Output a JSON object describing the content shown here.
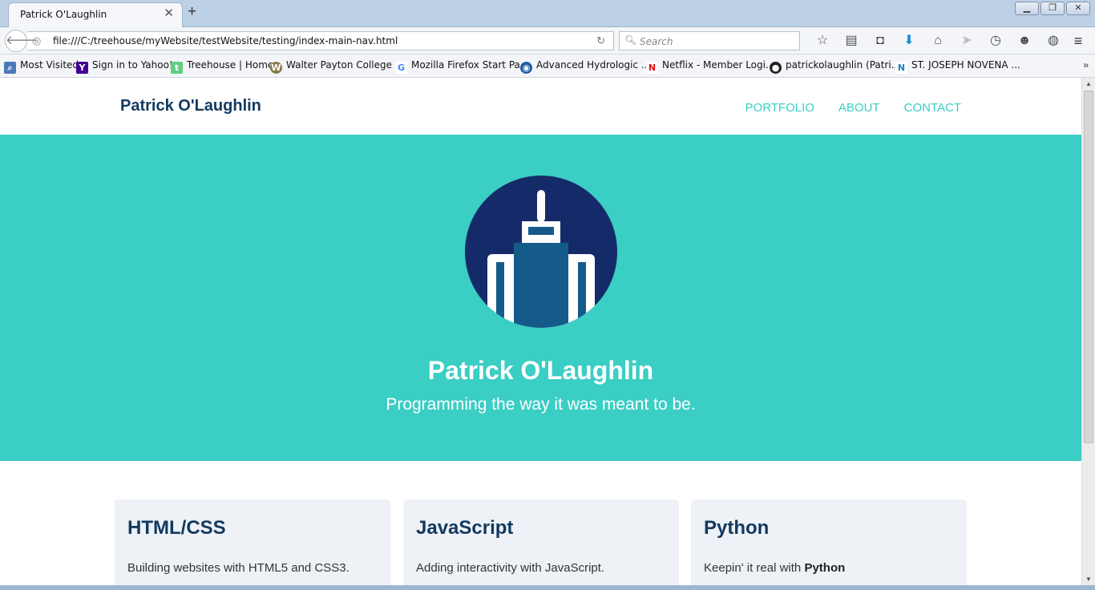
{
  "browser": {
    "tab_title": "Patrick O'Laughlin",
    "tab_close": "✕",
    "new_tab": "+",
    "window_buttons": [
      "▁",
      "❐",
      "✕"
    ],
    "url": "file:///C:/treehouse/myWebsite/testWebsite/testing/index-main-nav.html",
    "search_placeholder": "Search",
    "bookmarks": [
      {
        "label": "Most Visited",
        "icon": "most-visited-icon",
        "color": "#4a78b8",
        "glyph": "⌕"
      },
      {
        "label": "Sign in to Yahoo!",
        "icon": "yahoo-icon",
        "color": "#400191",
        "glyph": "Y"
      },
      {
        "label": "Treehouse | Home",
        "icon": "treehouse-icon",
        "color": "#5fcf80",
        "glyph": "t"
      },
      {
        "label": "Walter Payton College ...",
        "icon": "payton-college-icon",
        "color": "#8a7a4a",
        "glyph": "W"
      },
      {
        "label": "Mozilla Firefox Start Pa...",
        "icon": "google-icon",
        "color": "#ffffff",
        "glyph": "G"
      },
      {
        "label": "Advanced Hydrologic ...",
        "icon": "noaa-icon",
        "color": "#1f5aa6",
        "glyph": "◉"
      },
      {
        "label": "Netflix - Member Logi...",
        "icon": "netflix-icon",
        "color": "#ffffff",
        "glyph": "N"
      },
      {
        "label": "patrickolaughlin (Patri...",
        "icon": "github-icon",
        "color": "#222222",
        "glyph": "●"
      },
      {
        "label": "ST. JOSEPH NOVENA ...",
        "icon": "novena-icon",
        "color": "#ffffff",
        "glyph": "N"
      }
    ],
    "bookmarks_more": "»"
  },
  "site": {
    "brand": "Patrick O'Laughlin",
    "nav": [
      "PORTFOLIO",
      "ABOUT",
      "CONTACT"
    ],
    "hero_title": "Patrick O'Laughlin",
    "hero_tagline": "Programming the way it was meant to be.",
    "cards": [
      {
        "title": "HTML/CSS",
        "text": "Building websites with HTML5 and CSS3.",
        "bold": ""
      },
      {
        "title": "JavaScript",
        "text": "Adding interactivity with JavaScript.",
        "bold": ""
      },
      {
        "title": "Python",
        "text": "Keepin' it real with ",
        "bold": "Python"
      }
    ]
  },
  "colors": {
    "accent": "#3acec4",
    "brand": "#12395f",
    "avatar_bg": "#152b69",
    "building": "#155b8a"
  }
}
